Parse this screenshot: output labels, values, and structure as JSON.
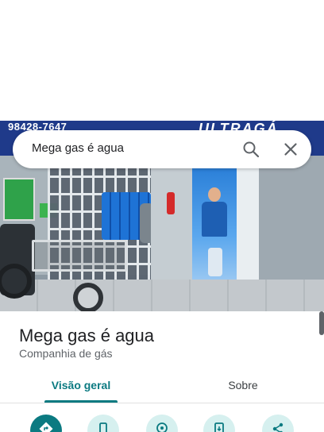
{
  "photo": {
    "sign_phone": "98428-7647",
    "sign_brand": "ULTRAGÁ"
  },
  "search": {
    "query": "Mega gas é agua",
    "search_icon": "search-icon",
    "close_icon": "close-icon"
  },
  "place": {
    "name": "Mega gas é agua",
    "category": "Companhia de gás"
  },
  "tabs": [
    {
      "label": "Visão geral",
      "active": true
    },
    {
      "label": "Sobre",
      "active": false
    }
  ],
  "actions": [
    {
      "icon": "directions-icon"
    },
    {
      "icon": "phone-icon"
    },
    {
      "icon": "map-pin-icon"
    },
    {
      "icon": "save-to-phone-icon"
    },
    {
      "icon": "share-icon"
    }
  ],
  "colors": {
    "accent": "#0b7a81",
    "accent_light": "#d6f0ef",
    "text_primary": "#202124",
    "text_secondary": "#5f6368"
  }
}
